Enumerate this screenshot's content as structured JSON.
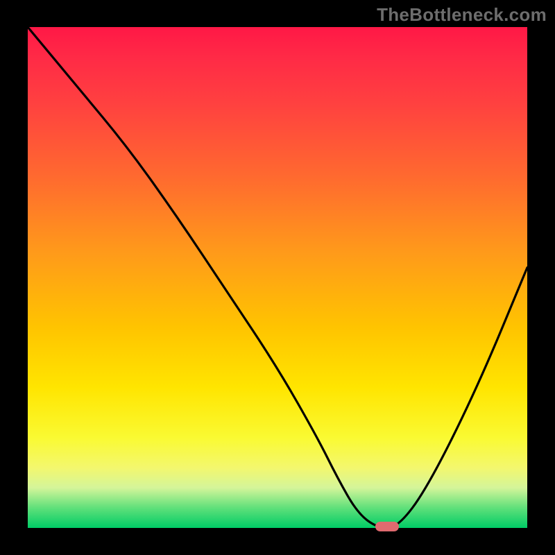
{
  "watermark": {
    "text": "TheBottleneck.com"
  },
  "chart_data": {
    "type": "line",
    "title": "",
    "xlabel": "",
    "ylabel": "",
    "xlim": [
      0,
      100
    ],
    "ylim": [
      0,
      100
    ],
    "grid": false,
    "series": [
      {
        "name": "bottleneck-curve",
        "x": [
          0,
          10,
          20,
          30,
          40,
          50,
          58,
          62,
          66,
          70,
          74,
          80,
          90,
          100
        ],
        "y": [
          100,
          88,
          76,
          62,
          47,
          32,
          18,
          10,
          3,
          0,
          0,
          8,
          28,
          52
        ]
      }
    ],
    "gradient_stops": [
      {
        "pos": 0,
        "color": "#ff1846"
      },
      {
        "pos": 15,
        "color": "#ff4040"
      },
      {
        "pos": 45,
        "color": "#ff9a1a"
      },
      {
        "pos": 72,
        "color": "#ffe500"
      },
      {
        "pos": 92,
        "color": "#d4f59a"
      },
      {
        "pos": 100,
        "color": "#00cc66"
      }
    ],
    "marker": {
      "x": 72,
      "y": 0,
      "color": "#e06a6f"
    }
  }
}
